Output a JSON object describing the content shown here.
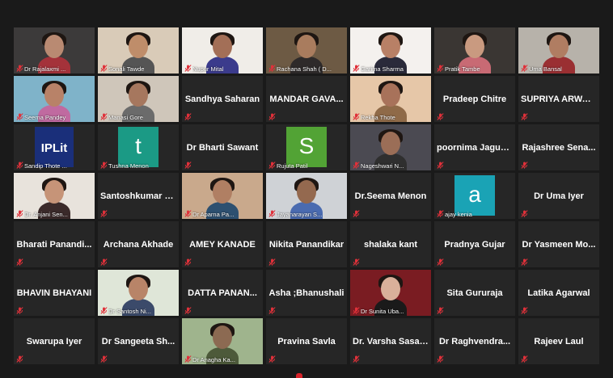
{
  "meeting": {
    "participants": [
      {
        "name": "Dr Rajalaxmi ...",
        "video": true,
        "bg": "#3c3a3a",
        "face": "#b98a72",
        "shirt": "#a4323a"
      },
      {
        "name": "Sonali Tawde",
        "video": true,
        "bg": "#d9cbb8",
        "face": "#bf8d6a",
        "shirt": "#555555"
      },
      {
        "name": "Nupur Mital",
        "video": true,
        "bg": "#f0ede8",
        "face": "#a36f57",
        "shirt": "#3b3b8c"
      },
      {
        "name": "Rachana Shah ( D...",
        "video": true,
        "bg": "#6d5a44",
        "face": "#a97c5e",
        "shirt": "#2e2a2a"
      },
      {
        "name": "Garima Sharma",
        "video": true,
        "bg": "#f4f1ee",
        "face": "#b88066",
        "shirt": "#2a2a3a"
      },
      {
        "name": "Pratik Tambe",
        "video": true,
        "bg": "#3a3633",
        "face": "#c99a80",
        "shirt": "#c86a74",
        "active": true
      },
      {
        "name": "Uma Bansal",
        "video": true,
        "bg": "#b7b2aa",
        "face": "#b07d62",
        "shirt": "#9a2f32"
      },
      {
        "name": "Seema Pandey",
        "video": true,
        "bg": "#7fb3c9",
        "face": "#b88268",
        "shirt": "#c06aa0"
      },
      {
        "name": "Manasi Gore",
        "video": true,
        "bg": "#cfc6ba",
        "face": "#a6775e",
        "shirt": "#6b6b6b"
      },
      {
        "name": "Sandhya Saharan",
        "video": false
      },
      {
        "name": "MANDAR GAVA...",
        "video": false
      },
      {
        "name": "Rekha Thote",
        "video": true,
        "bg": "#e6c7a8",
        "face": "#a8725a",
        "shirt": "#8f6a48"
      },
      {
        "name": "Pradeep Chitre",
        "video": false
      },
      {
        "name": "SUPRIYA ARWARI",
        "video": false
      },
      {
        "name": "Sandip Thote ...",
        "video": true,
        "logo": "IPLit"
      },
      {
        "name": "Tushna Menon",
        "video": true,
        "avatar": "t",
        "avatar_color": "#1b9a85"
      },
      {
        "name": "Dr Bharti Sawant",
        "video": false
      },
      {
        "name": "Rujuta Patil",
        "video": true,
        "avatar": "S",
        "avatar_color": "#52a335"
      },
      {
        "name": "Nageshwari N...",
        "video": true,
        "bg": "#4b4a52",
        "face": "#9b6e57",
        "shirt": "#2f2f2f"
      },
      {
        "name": "poornima Jaguste",
        "video": false
      },
      {
        "name": "Rajashree  Sena...",
        "video": false
      },
      {
        "name": "Dr. Anjani Sen...",
        "video": true,
        "bg": "#e8e3dc",
        "face": "#c69478",
        "shirt": "#3a2a2a"
      },
      {
        "name": "Santoshkumar  S...",
        "video": false
      },
      {
        "name": "Dr Aparna Pa...",
        "video": true,
        "bg": "#c9a98c",
        "face": "#b07f63",
        "shirt": "#2d5070"
      },
      {
        "name": "Jayanarayan S...",
        "video": true,
        "bg": "#cfd2d6",
        "face": "#94694f",
        "shirt": "#4a6bb0"
      },
      {
        "name": "Dr.Seema Menon",
        "video": false
      },
      {
        "name": "ajay kenia",
        "video": true,
        "avatar": "a",
        "avatar_color": "#1aa3b5"
      },
      {
        "name": "Dr Uma Iyer",
        "video": false
      },
      {
        "name": "Bharati  Panandi...",
        "video": false
      },
      {
        "name": "Archana Akhade",
        "video": false
      },
      {
        "name": "AMEY KANADE",
        "video": false
      },
      {
        "name": "Nikita Panandikar",
        "video": false
      },
      {
        "name": "shalaka kant",
        "video": false
      },
      {
        "name": "Pradnya Gujar",
        "video": false
      },
      {
        "name": "Dr  Yasmeen  Mo...",
        "video": false
      },
      {
        "name": "BHAVIN BHAYANI",
        "video": false
      },
      {
        "name": "Dr Santosh Ni...",
        "video": true,
        "bg": "#dfe6d8",
        "face": "#b88468",
        "shirt": "#3b4a6a"
      },
      {
        "name": "DATTA  PANAN...",
        "video": false
      },
      {
        "name": "Asha ;Bhanushali",
        "video": false
      },
      {
        "name": "Dr Sunita Uba...",
        "video": true,
        "bg": "#7a1c22",
        "face": "#d9b09a",
        "shirt": "#1a1a1a"
      },
      {
        "name": "Sita Gururaja",
        "video": false
      },
      {
        "name": "Latika Agarwal",
        "video": false
      },
      {
        "name": "Swarupa Iyer",
        "video": false
      },
      {
        "name": "Dr  Sangeeta  Sh...",
        "video": false
      },
      {
        "name": "Dr Anagha Ka...",
        "video": true,
        "bg": "#9fb48d",
        "face": "#8c6a52",
        "shirt": "#4d5a3a"
      },
      {
        "name": "Pravina Savla",
        "video": false
      },
      {
        "name": "Dr. Varsha Sasane",
        "video": false
      },
      {
        "name": "Dr  Raghvendra...",
        "video": false
      },
      {
        "name": "Rajeev Laul",
        "video": false
      }
    ]
  },
  "colors": {
    "background": "#1a1a1a",
    "tile": "#262626",
    "active_outline": "#c7d94a",
    "mic_muted": "#e0313a"
  }
}
